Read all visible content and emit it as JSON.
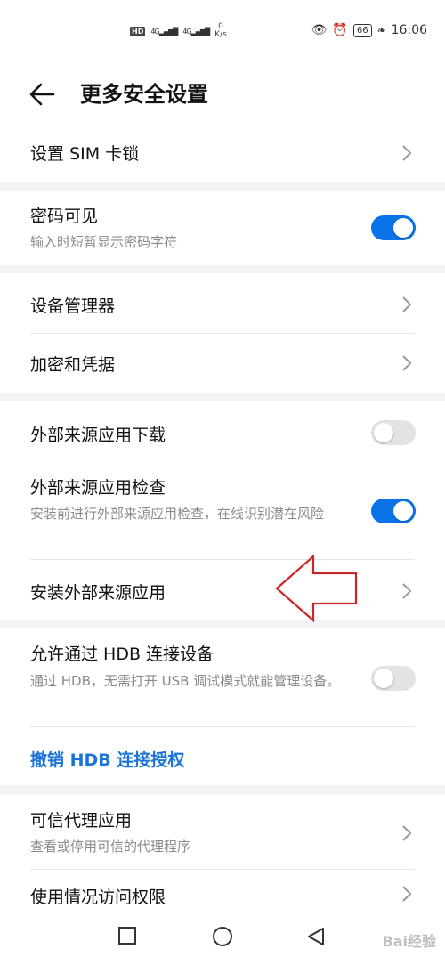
{
  "status_bar": {
    "hd_label": "HD",
    "signal1": "4G",
    "signal2": "4G",
    "speed_value": "0",
    "speed_unit": "K/s",
    "battery": "66",
    "time": "16:06"
  },
  "header": {
    "title": "更多安全设置"
  },
  "rows": {
    "sim_lock": {
      "title": "设置 SIM 卡锁"
    },
    "password_visible": {
      "title": "密码可见",
      "subtitle": "输入时短暂显示密码字符",
      "toggle": "on"
    },
    "device_admin": {
      "title": "设备管理器"
    },
    "encryption": {
      "title": "加密和凭据"
    },
    "external_download": {
      "title": "外部来源应用下载",
      "toggle": "off"
    },
    "external_check": {
      "title": "外部来源应用检查",
      "subtitle": "安装前进行外部来源应用检查，在线识别潜在风险",
      "toggle": "on"
    },
    "install_external": {
      "title": "安装外部来源应用"
    },
    "hdb_allow": {
      "title": "允许通过 HDB 连接设备",
      "subtitle": "通过 HDB，无需打开 USB 调试模式就能管理设备。",
      "toggle": "off"
    },
    "hdb_revoke": {
      "title": "撤销 HDB 连接授权"
    },
    "trust_agents": {
      "title": "可信代理应用",
      "subtitle": "查看或停用可信的代理程序"
    },
    "usage_access": {
      "title": "使用情况访问权限"
    }
  },
  "watermark": "Bai经验",
  "colors": {
    "accent": "#0a73e8",
    "link": "#1a73d9",
    "toggle_off": "#e3e3e3",
    "background": "#f1f3f5",
    "annotation_arrow": "#c62828"
  }
}
